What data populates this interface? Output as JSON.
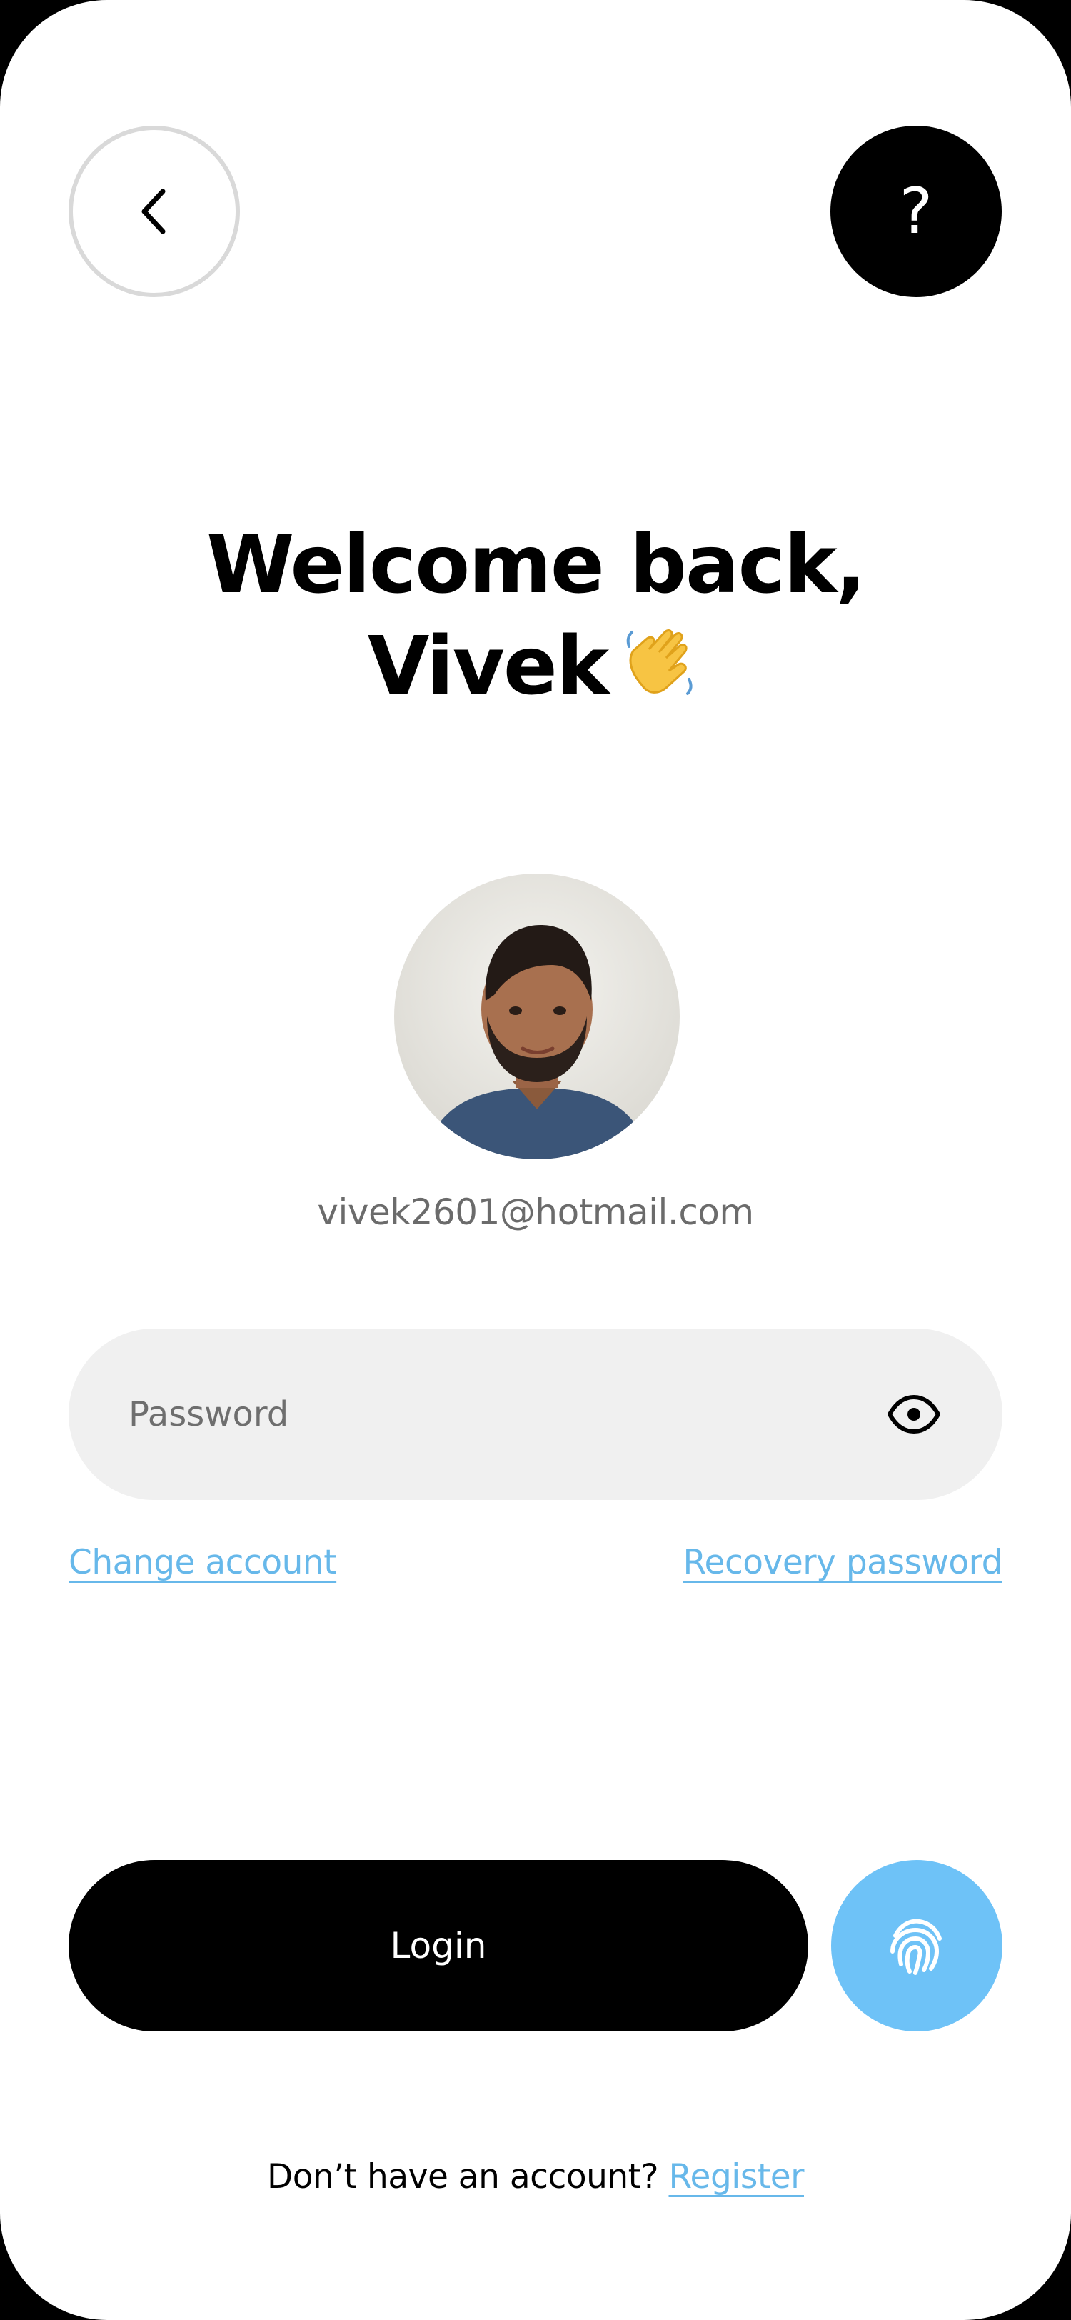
{
  "header": {
    "back_icon": "chevron-left-icon",
    "help_label": "?"
  },
  "greeting": {
    "line1": "Welcome back,",
    "line2": "Vivek",
    "emoji_icon": "waving-hand-icon"
  },
  "profile": {
    "avatar_icon": "user-avatar-photo",
    "email": "vivek2601@hotmail.com"
  },
  "password": {
    "placeholder": "Password",
    "value": "",
    "toggle_icon": "eye-icon"
  },
  "links": {
    "change_account": "Change account",
    "recovery_password": "Recovery password"
  },
  "actions": {
    "login_label": "Login",
    "biometric_icon": "fingerprint-icon"
  },
  "footer": {
    "prompt": "Don’t have an account?",
    "register_label": "Register"
  },
  "colors": {
    "accent": "#6ec2f7",
    "link": "#67b8ea",
    "field_bg": "#f0f0f0",
    "primary": "#000000"
  }
}
